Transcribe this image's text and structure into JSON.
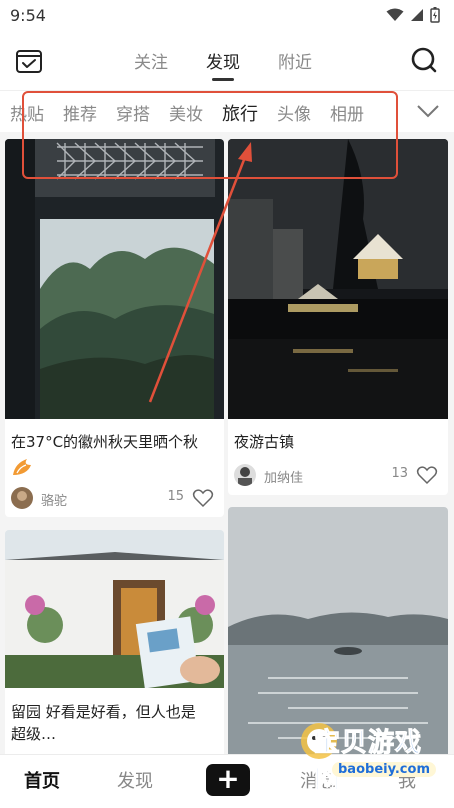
{
  "status_bar": {
    "time": "9:54"
  },
  "top_nav": {
    "tabs": [
      {
        "label": "关注"
      },
      {
        "label": "发现"
      },
      {
        "label": "附近"
      }
    ]
  },
  "categories": [
    "热贴",
    "推荐",
    "穿搭",
    "美妆",
    "旅行",
    "头像",
    "相册"
  ],
  "active_category": "旅行",
  "feed": {
    "cards": [
      {
        "title_line1": "在37°C的徽州秋天里晒个秋",
        "author": "骆驼",
        "likes": "15"
      },
      {
        "title_line1": "夜游古镇",
        "author": "加纳佳",
        "likes": "13"
      },
      {
        "title_line1": "留园 好看是好看，但人也是",
        "title_line2": "超级…"
      },
      {
        "title_line1": ""
      }
    ]
  },
  "bottom_nav": {
    "home": "首页",
    "discover": "发现",
    "post": "+",
    "messages": "消息",
    "me": "我"
  },
  "watermark": {
    "text": "宝贝游戏网",
    "url": "baobeiy.com"
  },
  "colors": {
    "highlight": "#e0503a",
    "accent": "#111111"
  }
}
